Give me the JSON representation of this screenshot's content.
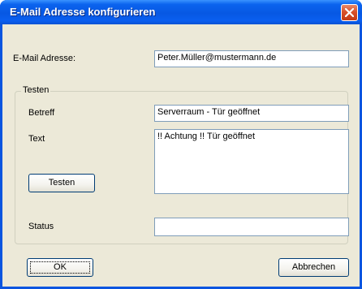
{
  "window": {
    "title": "E-Mail Adresse konfigurieren"
  },
  "email": {
    "label": "E-Mail Adresse:",
    "value": "Peter.Müller@mustermann.de"
  },
  "test_group": {
    "legend": "Testen",
    "subject_label": "Betreff",
    "subject_value": "Serverraum - Tür geöffnet",
    "text_label": "Text",
    "text_value": "!! Achtung !! Tür geöffnet",
    "test_button": "Testen"
  },
  "status": {
    "label": "Status",
    "value": ""
  },
  "buttons": {
    "ok": "OK",
    "cancel": "Abbrechen"
  }
}
